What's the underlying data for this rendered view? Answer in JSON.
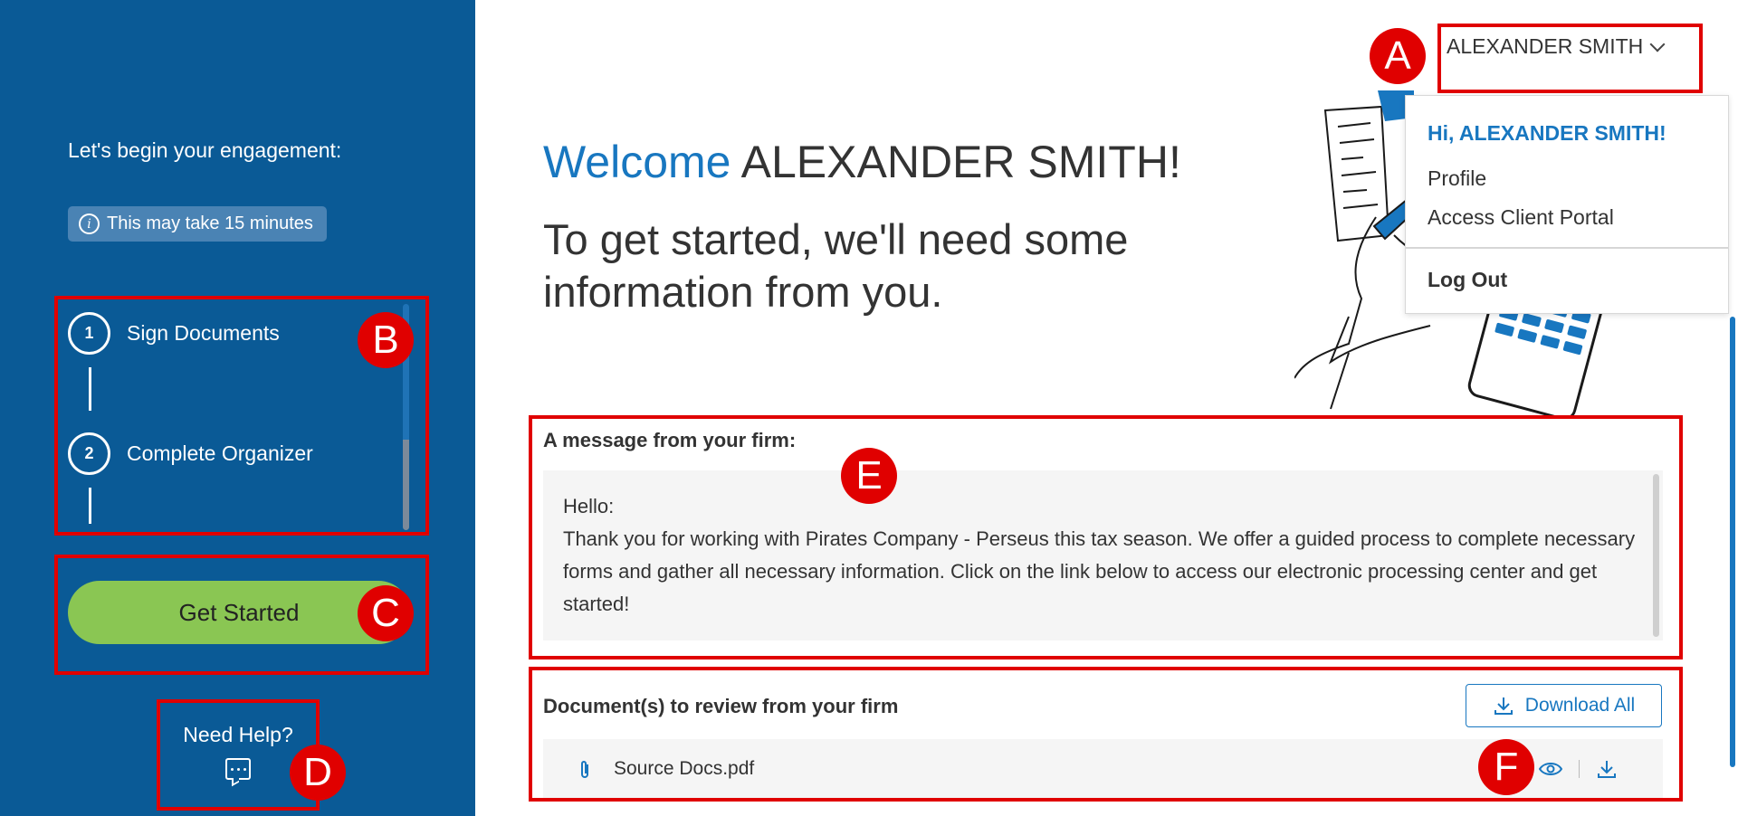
{
  "sidebar": {
    "intro": "Let's begin your engagement:",
    "time_badge": "This may take 15 minutes",
    "steps": [
      {
        "number": "1",
        "label": "Sign Documents"
      },
      {
        "number": "2",
        "label": "Complete Organizer"
      }
    ],
    "get_started_label": "Get Started",
    "help_label": "Need Help?"
  },
  "header": {
    "user_name": "ALEXANDER SMITH"
  },
  "welcome": {
    "accent": "Welcome",
    "name": "ALEXANDER SMITH!",
    "subtitle": "To get started, we'll need some information from you."
  },
  "dropdown": {
    "greeting": "Hi, ALEXANDER SMITH!",
    "items": [
      "Profile",
      "Access Client Portal"
    ],
    "logout": "Log Out"
  },
  "message": {
    "title": "A message from your firm:",
    "greeting": "Hello:",
    "body": "Thank you for working with Pirates Company - Perseus this tax season. We offer a guided process to complete necessary forms and gather all necessary information.  Click on the link below to access our electronic processing center and get started!"
  },
  "documents": {
    "title": "Document(s) to review from your firm",
    "download_all_label": "Download All",
    "files": [
      {
        "name": "Source Docs.pdf"
      }
    ]
  },
  "annotations": [
    "A",
    "B",
    "C",
    "D",
    "E",
    "F"
  ],
  "colors": {
    "sidebar": "#0a5a96",
    "accent": "#1877c0",
    "button": "#8ac653",
    "annotation": "#e00000"
  }
}
